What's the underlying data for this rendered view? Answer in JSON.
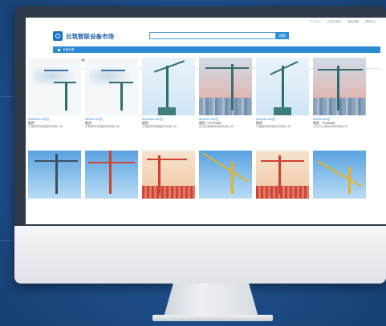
{
  "topbar": {
    "links": [
      "个人中心",
      "已购买商品",
      "我的收藏",
      "帮助中心"
    ]
  },
  "header": {
    "logo_text": "云筑智联设备市场",
    "search_placeholder": "",
    "search_button": "搜索"
  },
  "nav": {
    "label": "全部分类"
  },
  "filters": {
    "items": [
      "默认排序",
      "价格由低到高",
      "按成交量排序"
    ],
    "page_label": "1/8"
  },
  "products_row1": [
    {
      "price": "¥380000.00/台",
      "name": "塔吊",
      "company": "中建智联机械租赁有限公司"
    },
    {
      "price": "¥2000.00/台",
      "name": "塔吊",
      "company": "中联重科机械租赁有限公司"
    },
    {
      "price": "¥323000.00/台",
      "name": "塔吊",
      "company": "中建智联机械租赁有限公司"
    },
    {
      "price": "¥60000.00/台",
      "name": "塔吊（TC7030）",
      "company": "远大机械建筑机械有限公司"
    },
    {
      "price": "¥52000.00/台",
      "name": "塔吊",
      "company": "中建智联机械租赁有限公司"
    },
    {
      "price": "¥3000.00/台",
      "name": "塔吊（TC6030）",
      "company": "山东大汉建设机械有限公司"
    }
  ],
  "icons": {
    "logo": "crane-logo-icon",
    "nav": "menu-icon",
    "prev": "chevron-left-icon",
    "next": "chevron-right-icon",
    "sort_price": "arrow-up-icon",
    "sort_volume": "arrow-down-icon"
  },
  "colors": {
    "accent": "#2d8fd8",
    "background": "#1e4f8a"
  }
}
